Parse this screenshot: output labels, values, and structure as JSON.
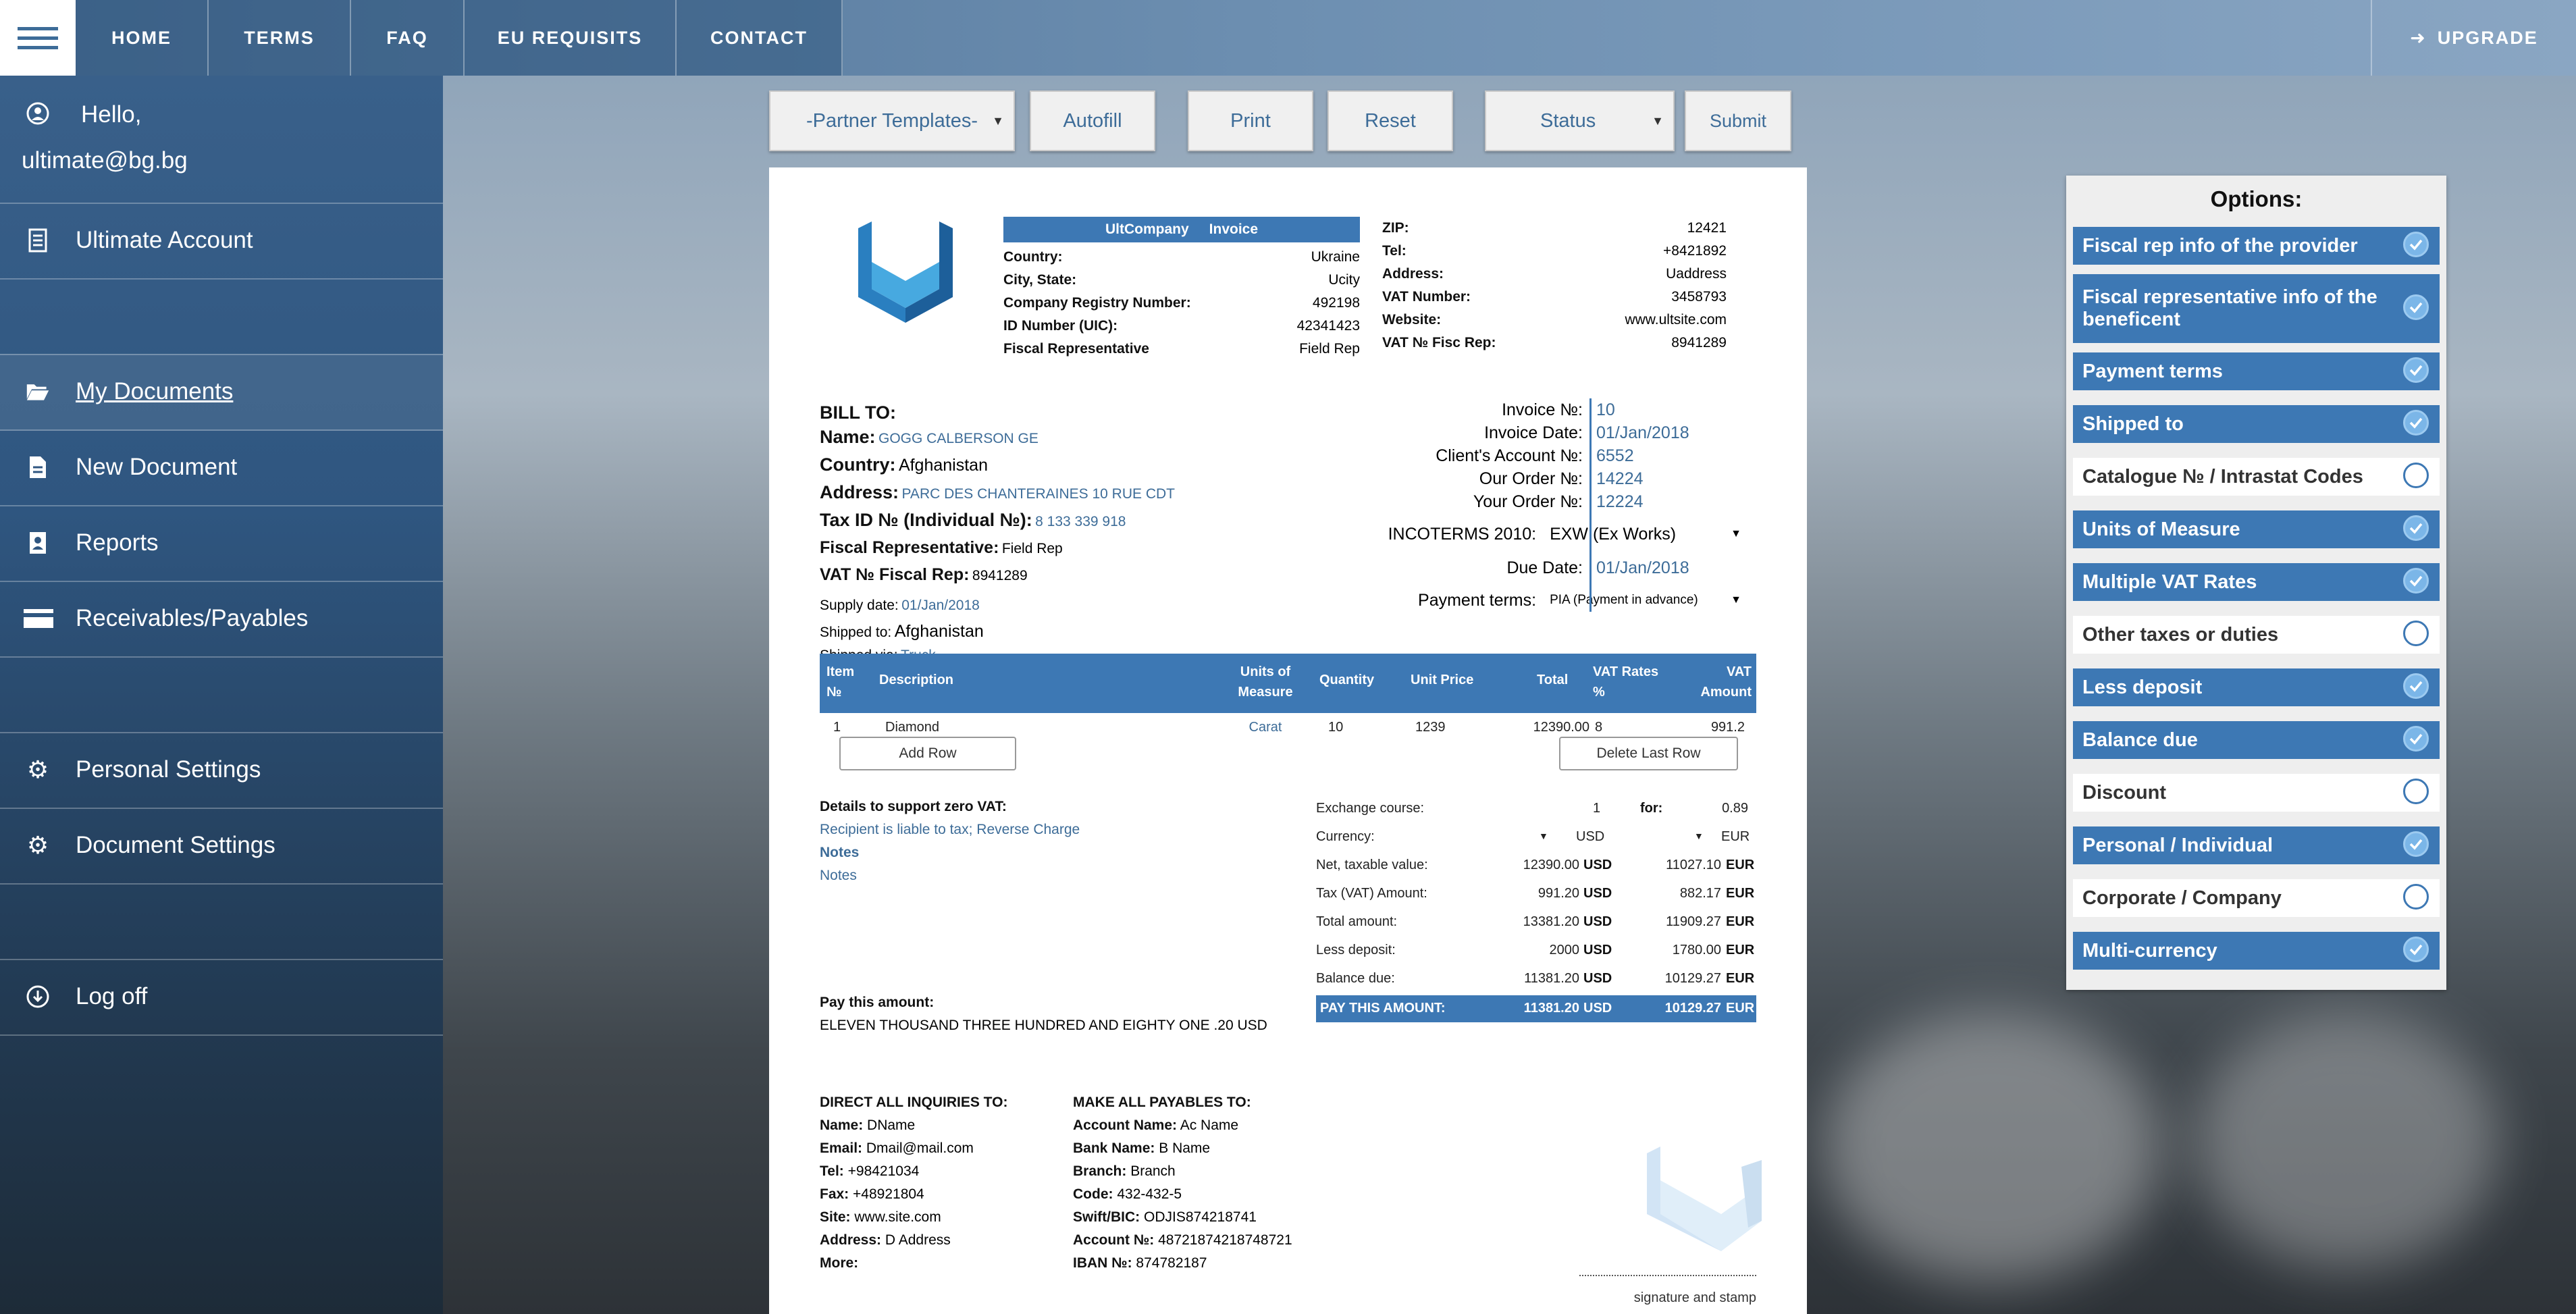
{
  "nav": {
    "items": [
      "HOME",
      "TERMS",
      "FAQ",
      "EU REQUISITS",
      "CONTACT"
    ],
    "upgrade": "UPGRADE"
  },
  "sidebar": {
    "hello": "Hello,",
    "email": "ultimate@bg.bg",
    "account": "Ultimate Account",
    "my_documents": "My Documents",
    "new_document": "New Document",
    "reports": "Reports",
    "receivables": "Receivables/Payables",
    "personal_settings": "Personal Settings",
    "document_settings": "Document Settings",
    "log_off": "Log off"
  },
  "toolbar": {
    "partner_templates": "-Partner Templates-",
    "autofill": "Autofill",
    "print": "Print",
    "reset": "Reset",
    "status": "Status",
    "submit": "Submit"
  },
  "company": {
    "band_name": "UltCompany",
    "band_doc": "Invoice",
    "fields": [
      {
        "label": "Country:",
        "value": "Ukraine"
      },
      {
        "label": "City, State:",
        "value": "Ucity"
      },
      {
        "label": "Company Registry Number:",
        "value": "492198"
      },
      {
        "label": "ID Number (UIC):",
        "value": "42341423"
      },
      {
        "label": "Fiscal Representative",
        "value": "Field Rep"
      }
    ],
    "right_fields": [
      {
        "label": "ZIP:",
        "value": "12421"
      },
      {
        "label": "Tel:",
        "value": "+8421892"
      },
      {
        "label": "Address:",
        "value": "Uaddress"
      },
      {
        "label": "VAT Number:",
        "value": "3458793"
      },
      {
        "label": "Website:",
        "value": "www.ultsite.com"
      },
      {
        "label": "VAT № Fisc Rep:",
        "value": "8941289"
      }
    ]
  },
  "bill_to": {
    "heading": "BILL TO:",
    "name_label": "Name:",
    "name": "GOGG CALBERSON GE",
    "country_label": "Country:",
    "country": "Afghanistan",
    "address_label": "Address:",
    "address": "PARC DES CHANTERAINES 10 RUE CDT",
    "taxid_label": "Tax ID № (Individual №):",
    "taxid": "8 133 339 918",
    "fiscal_label": "Fiscal Representative:",
    "fiscal": "Field Rep",
    "vatfisc_label": "VAT № Fiscal Rep:",
    "vatfisc": "8941289",
    "supply_label": "Supply date:",
    "supply": "01/Jan/2018",
    "shipped_to_label": "Shipped to:",
    "shipped_to": "Afghanistan",
    "shipped_via_label": "Shipped via:",
    "shipped_via": "Truck"
  },
  "invoice_meta": {
    "invoice_no_label": "Invoice №:",
    "invoice_no": "10",
    "invoice_date_label": "Invoice Date:",
    "invoice_date": "01/Jan/2018",
    "client_acc_label": "Client's Account №:",
    "client_acc": "6552",
    "our_order_label": "Our Order №:",
    "our_order": "14224",
    "your_order_label": "Your Order №:",
    "your_order": "12224",
    "incoterms_label": "INCOTERMS 2010:",
    "incoterms": "EXW (Ex Works)",
    "due_label": "Due Date:",
    "due": "01/Jan/2018",
    "payment_label": "Payment terms:",
    "payment": "PIA (Payment in advance)"
  },
  "items_table": {
    "headers": {
      "item": "Item №",
      "description": "Description",
      "units": "Units of Measure",
      "quantity": "Quantity",
      "unit_price": "Unit Price",
      "total": "Total",
      "vat_rate": "VAT Rates %",
      "vat_amount": "VAT Amount"
    },
    "rows": [
      {
        "item": "1",
        "description": "Diamond",
        "units": "Carat",
        "quantity": "10",
        "unit_price": "1239",
        "total": "12390.00",
        "vat_rate": "8",
        "vat_amount": "991.2"
      }
    ],
    "add_row": "Add Row",
    "delete_row": "Delete Last Row"
  },
  "zero_vat": {
    "heading": "Details to support zero VAT:",
    "text": "Recipient is liable to tax; Reverse Charge",
    "notes_heading": "Notes",
    "notes": "Notes"
  },
  "totals": {
    "exchange_label": "Exchange course:",
    "exchange_value": "1",
    "for_label": "for:",
    "for_value": "0.89",
    "currency_label": "Currency:",
    "currency_1": "USD",
    "currency_2": "EUR",
    "rows": [
      {
        "label": "Net, taxable value:",
        "v1": "12390.00",
        "c1": "USD",
        "v2": "11027.10",
        "c2": "EUR"
      },
      {
        "label": "Tax (VAT) Amount:",
        "v1": "991.20",
        "c1": "USD",
        "v2": "882.17",
        "c2": "EUR"
      },
      {
        "label": "Total amount:",
        "v1": "13381.20",
        "c1": "USD",
        "v2": "11909.27",
        "c2": "EUR"
      },
      {
        "label": "Less deposit:",
        "v1": "2000",
        "c1": "USD",
        "v2": "1780.00",
        "c2": "EUR"
      },
      {
        "label": "Balance due:",
        "v1": "11381.20",
        "c1": "USD",
        "v2": "10129.27",
        "c2": "EUR"
      }
    ],
    "pay": {
      "label": "PAY THIS AMOUNT:",
      "v1": "11381.20",
      "c1": "USD",
      "v2": "10129.27",
      "c2": "EUR"
    }
  },
  "pay_amount": {
    "label": "Pay this amount:",
    "words": "ELEVEN THOUSAND THREE HUNDRED AND EIGHTY ONE .20 USD"
  },
  "inquiries": {
    "heading": "DIRECT ALL INQUIRIES TO:",
    "fields": [
      {
        "label": "Name:",
        "value": "DName"
      },
      {
        "label": "Email:",
        "value": "Dmail@mail.com"
      },
      {
        "label": "Tel:",
        "value": "+98421034"
      },
      {
        "label": "Fax:",
        "value": "+48921804"
      },
      {
        "label": "Site:",
        "value": "www.site.com"
      },
      {
        "label": "Address:",
        "value": "D Address"
      },
      {
        "label": "More:",
        "value": ""
      }
    ]
  },
  "payables": {
    "heading": "MAKE ALL PAYABLES TO:",
    "fields": [
      {
        "label": "Account Name:",
        "value": "Ac Name"
      },
      {
        "label": "Bank Name:",
        "value": "B Name"
      },
      {
        "label": "Branch:",
        "value": "Branch"
      },
      {
        "label": "Code:",
        "value": "432-432-5"
      },
      {
        "label": "Swift/BIC:",
        "value": "ODJIS874218741"
      },
      {
        "label": "Account №:",
        "value": "48721874218748721"
      },
      {
        "label": "IBAN №:",
        "value": "874782187"
      }
    ]
  },
  "signature": "signature and stamp",
  "options": {
    "title": "Options:",
    "items": [
      {
        "label": "Fiscal rep info of the provider",
        "checked": true
      },
      {
        "label": "Fiscal representative info of the beneficent",
        "checked": true
      },
      {
        "label": "Payment terms",
        "checked": true
      },
      {
        "label": "Shipped to",
        "checked": true
      },
      {
        "label": "Catalogue № / Intrastat Codes",
        "checked": false
      },
      {
        "label": "Units of Measure",
        "checked": true
      },
      {
        "label": "Multiple VAT Rates",
        "checked": true
      },
      {
        "label": "Other taxes or duties",
        "checked": false
      },
      {
        "label": "Less deposit",
        "checked": true
      },
      {
        "label": "Balance due",
        "checked": true
      },
      {
        "label": "Discount",
        "checked": false
      },
      {
        "label": "Personal / Individual",
        "checked": true
      },
      {
        "label": "Corporate / Company",
        "checked": false
      },
      {
        "label": "Multi-currency",
        "checked": true
      }
    ]
  },
  "colors": {
    "accent": "#3d78b4",
    "sidebar": "#2f5680"
  },
  "icons": [
    "menu-icon",
    "upgrade-arrow-icon",
    "user-icon",
    "account-icon",
    "folder-icon",
    "document-icon",
    "reports-icon",
    "card-icon",
    "gear-icon",
    "logoff-icon",
    "logo-icon",
    "check-icon"
  ]
}
